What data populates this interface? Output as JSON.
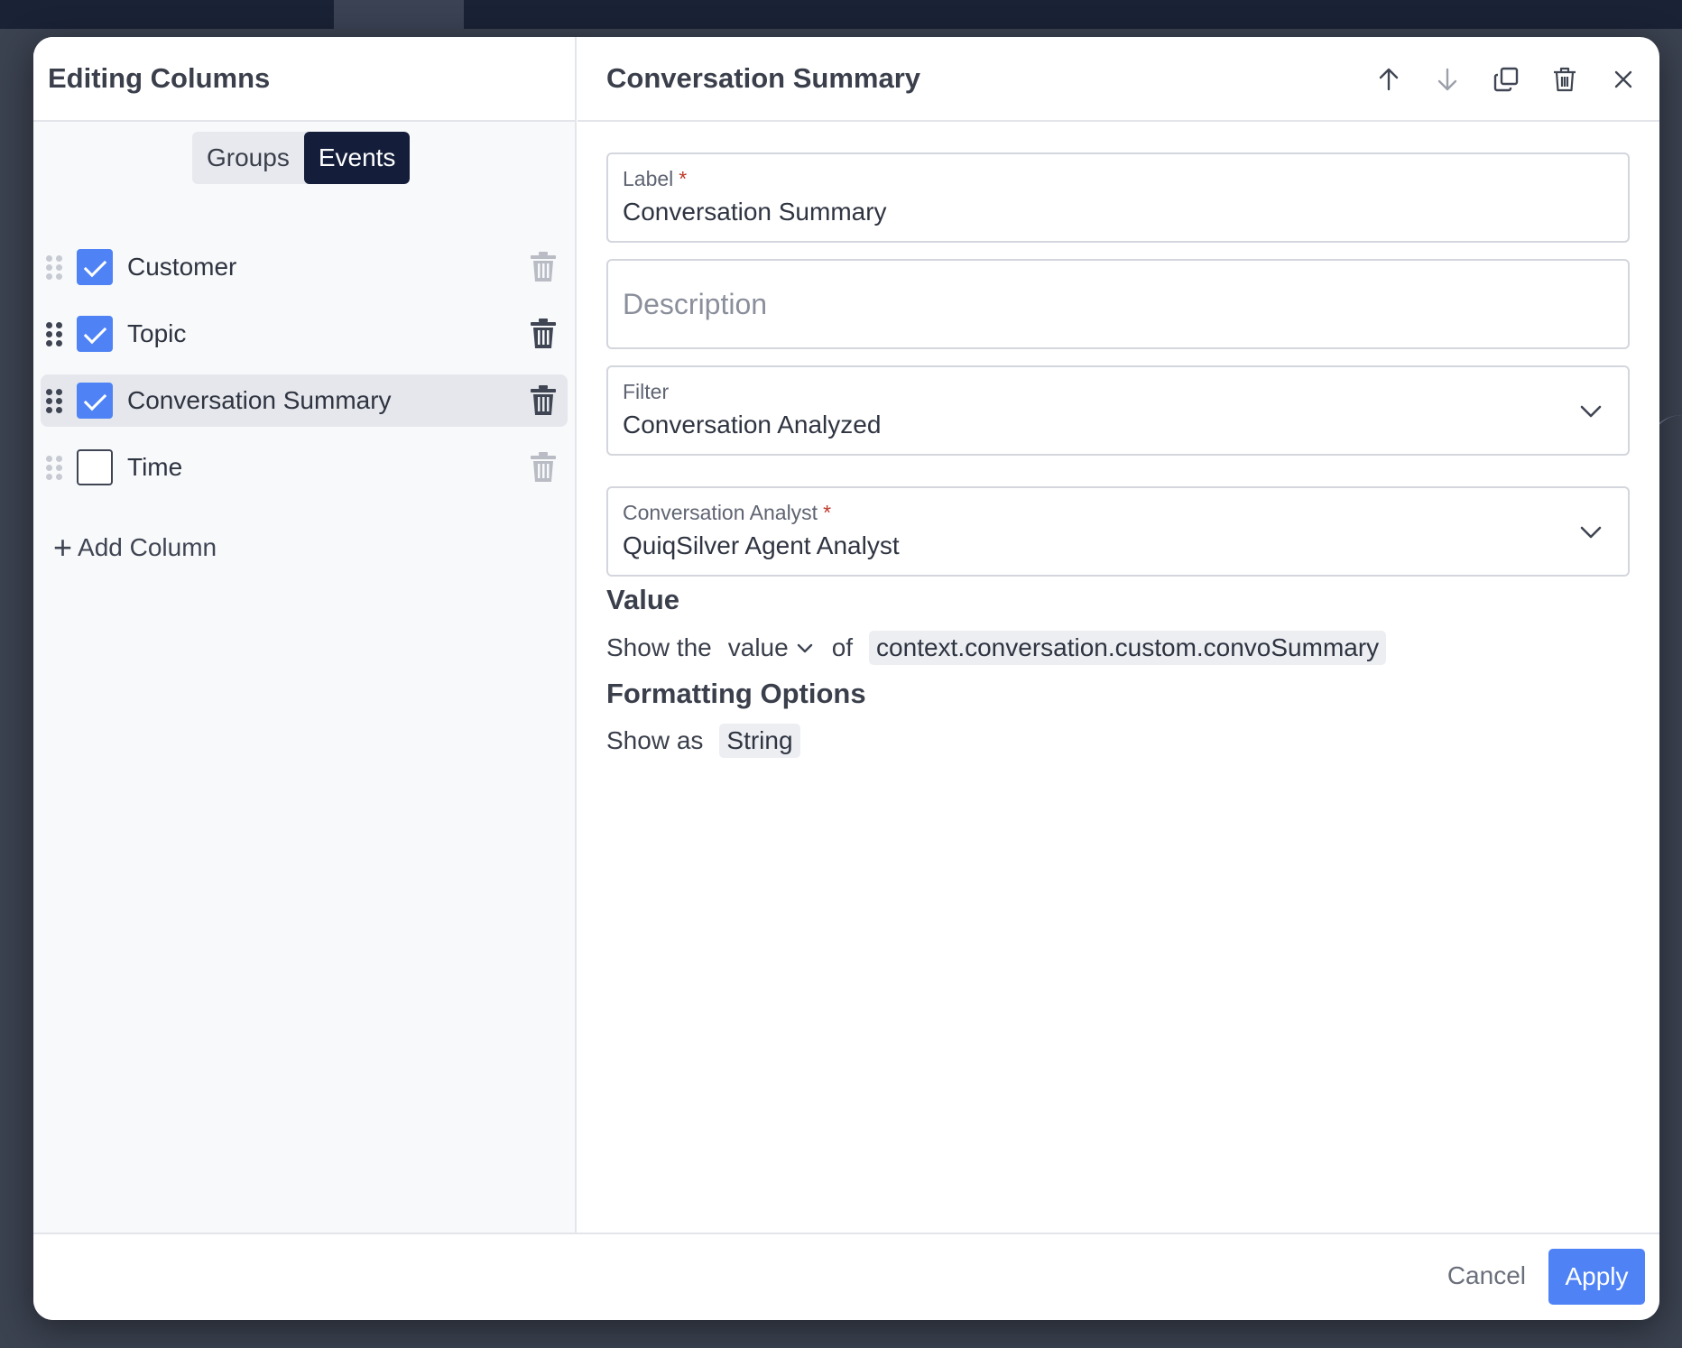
{
  "left": {
    "title": "Editing Columns",
    "tabs": [
      {
        "label": "Groups",
        "active": false
      },
      {
        "label": "Events",
        "active": true
      }
    ],
    "columns": [
      {
        "label": "Customer",
        "checked": true
      },
      {
        "label": "Topic",
        "checked": true
      },
      {
        "label": "Conversation Summary",
        "checked": true,
        "selected": true
      },
      {
        "label": "Time",
        "checked": false
      }
    ],
    "add_column_label": "Add Column"
  },
  "right": {
    "title": "Conversation Summary",
    "label_field": {
      "label": "Label",
      "value": "Conversation Summary"
    },
    "description_field": {
      "placeholder": "Description"
    },
    "filter_field": {
      "label": "Filter",
      "value": "Conversation Analyzed"
    },
    "analyst_field": {
      "label": "Conversation Analyst",
      "value": "QuiqSilver Agent Analyst"
    },
    "value_section": {
      "title": "Value",
      "prefix": "Show the",
      "mode": "value",
      "of": "of",
      "path": "context.conversation.custom.convoSummary"
    },
    "formatting_section": {
      "title": "Formatting Options",
      "prefix": "Show as",
      "type": "String"
    }
  },
  "footer": {
    "cancel_label": "Cancel",
    "apply_label": "Apply"
  },
  "colors": {
    "accent": "#4f83f5",
    "tab_active": "#141e3a",
    "required": "#c0392b"
  }
}
